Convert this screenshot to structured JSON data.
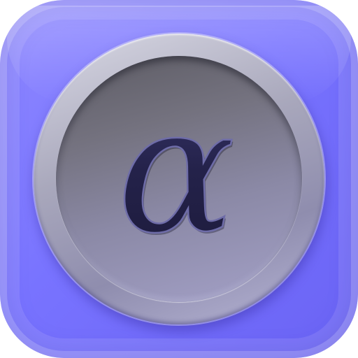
{
  "icon": {
    "glyph": "α",
    "symbol_name": "alpha-icon",
    "colors": {
      "background": "#7873ff",
      "dial_ring": "#b7b5d6",
      "dial_face": "#74727f",
      "glyph_fill": "#2a2850",
      "glyph_highlight": "#6e6ca8"
    }
  }
}
